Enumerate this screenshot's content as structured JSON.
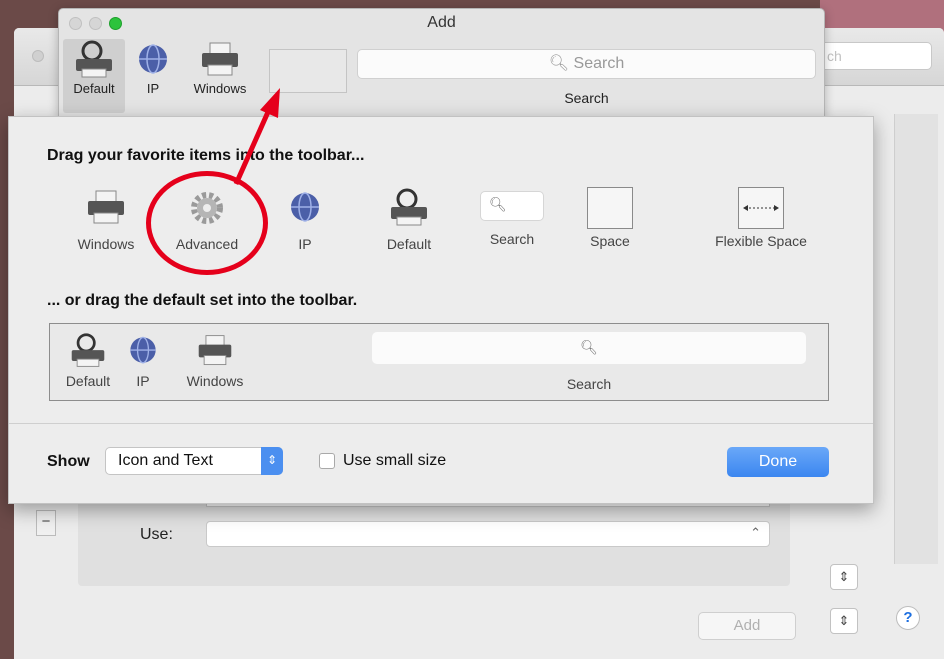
{
  "background": {
    "search_partial": "ch",
    "use_label": "Use:",
    "add_button": "Add",
    "help_label": "?",
    "minus_label": "−",
    "stepper_glyph": "⌃⌄"
  },
  "add_window": {
    "title": "Add",
    "toolbar": {
      "items": [
        {
          "label": "Default",
          "icon": "default-printer-icon"
        },
        {
          "label": "IP",
          "icon": "globe-icon"
        },
        {
          "label": "Windows",
          "icon": "printer-icon"
        }
      ],
      "search_placeholder": "Search",
      "search_label": "Search"
    }
  },
  "customize_sheet": {
    "heading_favorites": "Drag your favorite items into the toolbar...",
    "palette": [
      {
        "label": "Windows",
        "icon": "printer-icon"
      },
      {
        "label": "Advanced",
        "icon": "gear-icon"
      },
      {
        "label": "IP",
        "icon": "globe-icon"
      },
      {
        "label": "Default",
        "icon": "default-printer-icon"
      },
      {
        "label": "Search",
        "icon": "search-field-icon"
      },
      {
        "label": "Space",
        "icon": "space-icon"
      },
      {
        "label": "Flexible Space",
        "icon": "flexible-space-icon"
      }
    ],
    "heading_default_set": "... or drag the default set into the toolbar.",
    "default_set": [
      {
        "label": "Default"
      },
      {
        "label": "IP"
      },
      {
        "label": "Windows"
      }
    ],
    "default_set_search_label": "Search",
    "show_label": "Show",
    "show_value": "Icon and Text",
    "use_small_size_label": "Use small size",
    "use_small_size_checked": false,
    "done_label": "Done"
  },
  "colors": {
    "accent": "#3b86f0",
    "annotation": "#e5001b"
  }
}
